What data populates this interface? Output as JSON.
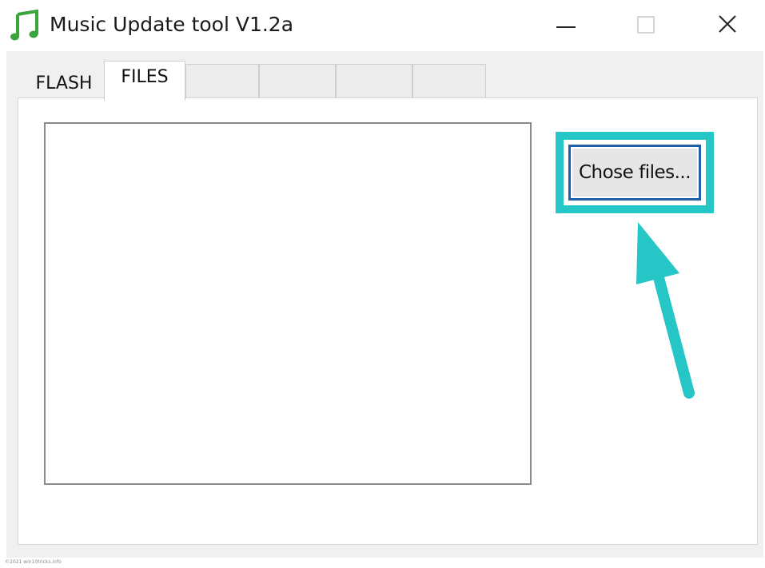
{
  "window": {
    "title": "Music Update tool V1.2a",
    "app_icon": "music-note-icon",
    "controls": {
      "minimize_icon": "minimize-icon",
      "maximize_icon": "maximize-icon",
      "close_icon": "close-icon"
    }
  },
  "tabs": [
    {
      "label": "FLASH",
      "selected": false
    },
    {
      "label": "FILES",
      "selected": true
    },
    {
      "label": "",
      "selected": false
    },
    {
      "label": "",
      "selected": false
    },
    {
      "label": "",
      "selected": false
    },
    {
      "label": "",
      "selected": false
    }
  ],
  "files_panel": {
    "file_list_items": [],
    "choose_button_label": "Chose files..."
  },
  "annotation": {
    "highlight_color": "#26c6c6",
    "arrow_color": "#26c6c6"
  },
  "footer": {
    "watermark": "©2021 win10tricks.info"
  },
  "colors": {
    "accent_border": "#1f5fa8",
    "icon_green": "#3aa53a"
  }
}
